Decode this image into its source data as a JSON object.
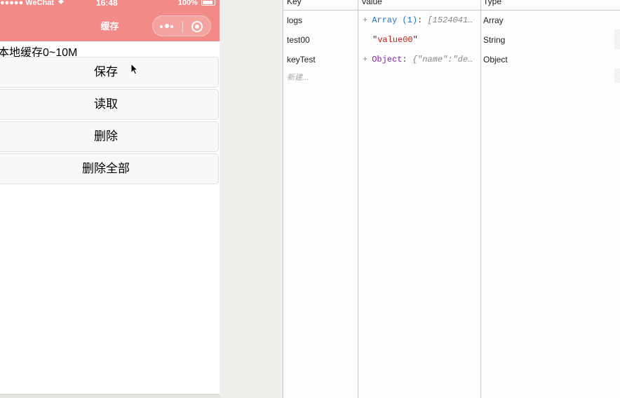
{
  "status_bar": {
    "carrier": "●●●●● WeChat",
    "time": "16:48",
    "battery": "100%"
  },
  "navbar": {
    "title": "缓存"
  },
  "page": {
    "section_label": "本地缓存0~10M",
    "buttons": {
      "save": "保存",
      "read": "读取",
      "delete": "删除",
      "delete_all": "删除全部"
    }
  },
  "storage": {
    "headers": {
      "key": "Key",
      "value": "Value",
      "type": "Type"
    },
    "rows": [
      {
        "key": "logs",
        "value_type": "Array",
        "value_meta": "(1)",
        "value_preview": "[1524041…",
        "type": "Array"
      },
      {
        "key": "test00",
        "value_string": "value00",
        "type": "String"
      },
      {
        "key": "keyTest",
        "value_type": "Object",
        "value_preview_key": "\"name\"",
        "value_preview_rest": "\"de…",
        "type": "Object"
      }
    ],
    "new_item_placeholder": "新建..."
  },
  "colors": {
    "navbar": "#f28a87",
    "array_type": "#1f6fc5",
    "object_type": "#8a1ea8",
    "string_value": "#c41a16"
  }
}
